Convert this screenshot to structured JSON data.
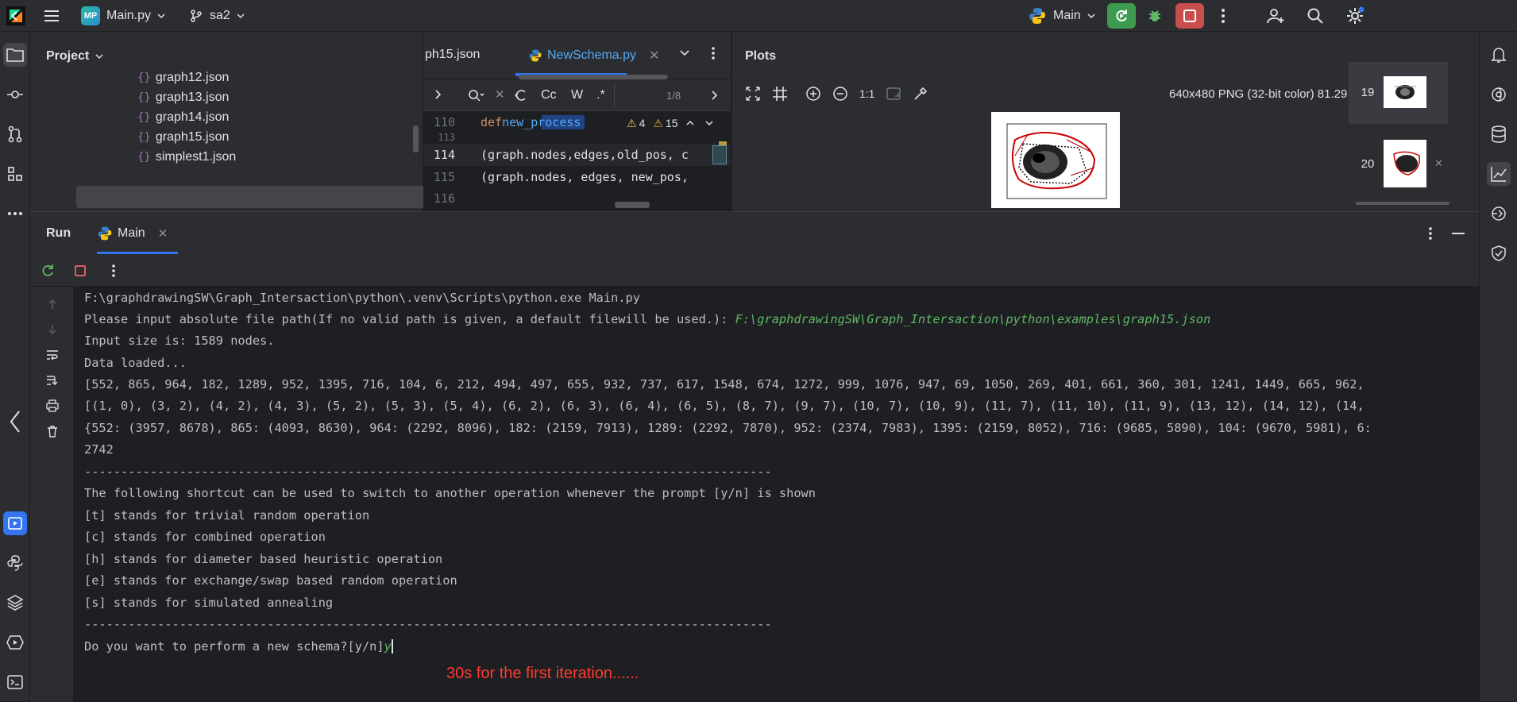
{
  "titlebar": {
    "project_badge": "MP",
    "project_name": "Main.py",
    "branch": "sa2",
    "run_config": "Main"
  },
  "project_panel": {
    "title": "Project",
    "files": [
      "graph12.json",
      "graph13.json",
      "graph14.json",
      "graph15.json",
      "simplest1.json"
    ],
    "selected": "graph15.json"
  },
  "editor": {
    "tabs": [
      {
        "label": "ph15.json"
      },
      {
        "label": "NewSchema.py",
        "active": true
      }
    ],
    "find": {
      "case_label": "Cc",
      "word_label": "W",
      "regex_label": ".*",
      "match_count": "1/8"
    },
    "warnings": {
      "triangle_count": "4",
      "weak_count": "15"
    },
    "lines": [
      {
        "num": "110",
        "kw": "def ",
        "fn": "new_process"
      },
      {
        "num": "113",
        "text": ""
      },
      {
        "num": "114",
        "text": "(graph.nodes,edges,old_pos, c"
      },
      {
        "num": "115",
        "text": "(graph.nodes, edges, new_pos,"
      },
      {
        "num": "116",
        "text": ""
      }
    ]
  },
  "plots": {
    "title": "Plots",
    "zoom_label": "1:1",
    "image_info": "640x480 PNG (32-bit color) 81.29 kB",
    "thumbnails": [
      {
        "index": "19"
      },
      {
        "index": "20"
      }
    ]
  },
  "run": {
    "tab_run": "Run",
    "tab_main": "Main",
    "console": [
      {
        "text": "F:\\graphdrawingSW\\Graph_Intersaction\\python\\.venv\\Scripts\\python.exe Main.py"
      },
      {
        "text": "Please input absolute file path(If no valid path is given, a default filewill be used.): ",
        "input": "F:\\graphdrawingSW\\Graph_Intersaction\\python\\examples\\graph15.json"
      },
      {
        "text": "Input size is: 1589 nodes."
      },
      {
        "text": "Data loaded..."
      },
      {
        "text": "[552, 865, 964, 182, 1289, 952, 1395, 716, 104, 6, 212, 494, 497, 655, 932, 737, 617, 1548, 674, 1272, 999, 1076, 947, 69, 1050, 269, 401, 661, 360, 301, 1241, 1449, 665, 962,"
      },
      {
        "text": "[(1, 0), (3, 2), (4, 2), (4, 3), (5, 2), (5, 3), (5, 4), (6, 2), (6, 3), (6, 4), (6, 5), (8, 7), (9, 7), (10, 7), (10, 9), (11, 7), (11, 10), (11, 9), (13, 12), (14, 12), (14,"
      },
      {
        "text": "{552: (3957, 8678), 865: (4093, 8630), 964: (2292, 8096), 182: (2159, 7913), 1289: (2292, 7870), 952: (2374, 7983), 1395: (2159, 8052), 716: (9685, 5890), 104: (9670, 5981), 6:"
      },
      {
        "text": "2742"
      },
      {
        "text": "----------------------------------------------------------------------------------------------"
      },
      {
        "text": "The following shortcut can be used to switch to another operation whenever the prompt [y/n] is shown"
      },
      {
        "text": "[t] stands for trivial random operation"
      },
      {
        "text": "[c] stands for combined operation"
      },
      {
        "text": "[h] stands for diameter based heuristic operation"
      },
      {
        "text": "[e] stands for exchange/swap based random operation"
      },
      {
        "text": "[s] stands for simulated annealing"
      },
      {
        "text": "----------------------------------------------------------------------------------------------"
      },
      {
        "text": "Do you want to perform a new schema?[y/n]",
        "input": "y"
      }
    ],
    "annotation": "30s for the first iteration......"
  }
}
